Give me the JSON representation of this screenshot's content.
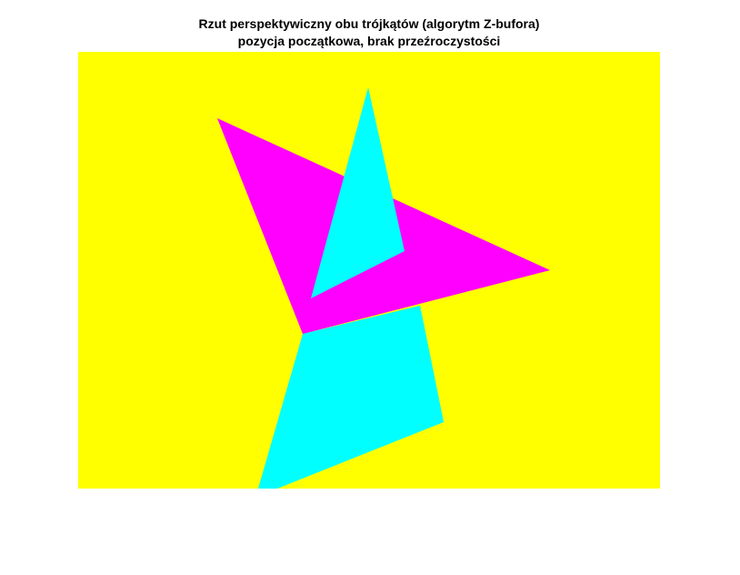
{
  "figure": {
    "title_line1": "Rzut perspektywiczny obu trójkątów (algorytm Z-bufora)",
    "title_line2": "pozycja początkowa, brak przeźroczystości"
  },
  "colors": {
    "background": "#ffffff",
    "canvas": "#ffff00",
    "triangle_magenta": "#ff00ff",
    "triangle_cyan": "#00ffff"
  }
}
